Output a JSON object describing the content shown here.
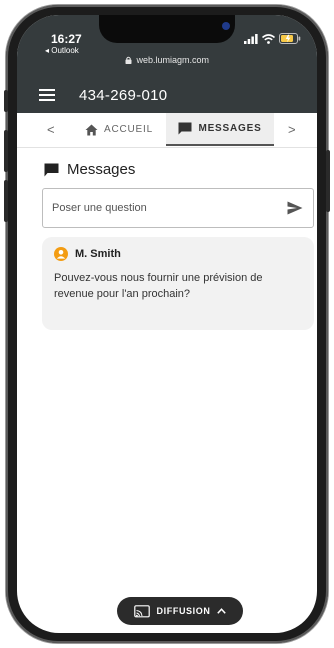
{
  "status": {
    "time": "16:27",
    "back_app": "◂ Outlook",
    "url": "web.lumiagm.com"
  },
  "header": {
    "title": "434-269-010"
  },
  "tabs": {
    "prev_arrow": "<",
    "next_arrow": ">",
    "items": [
      {
        "label": "ACCUEIL",
        "icon": "home-icon",
        "active": false
      },
      {
        "label": "MESSAGES",
        "icon": "message-icon",
        "active": true
      }
    ]
  },
  "messages_section": {
    "title": "Messages",
    "input_placeholder": "Poser une question",
    "input_value": ""
  },
  "message": {
    "author": "M. Smith",
    "text": "Pouvez-vous nous fournir une prévision de revenue pour l'an prochain?"
  },
  "diffusion": {
    "label": "DIFFUSION"
  },
  "colors": {
    "header_bg": "#353b3d",
    "avatar": "#f39c12",
    "battery": "#f7c948"
  }
}
